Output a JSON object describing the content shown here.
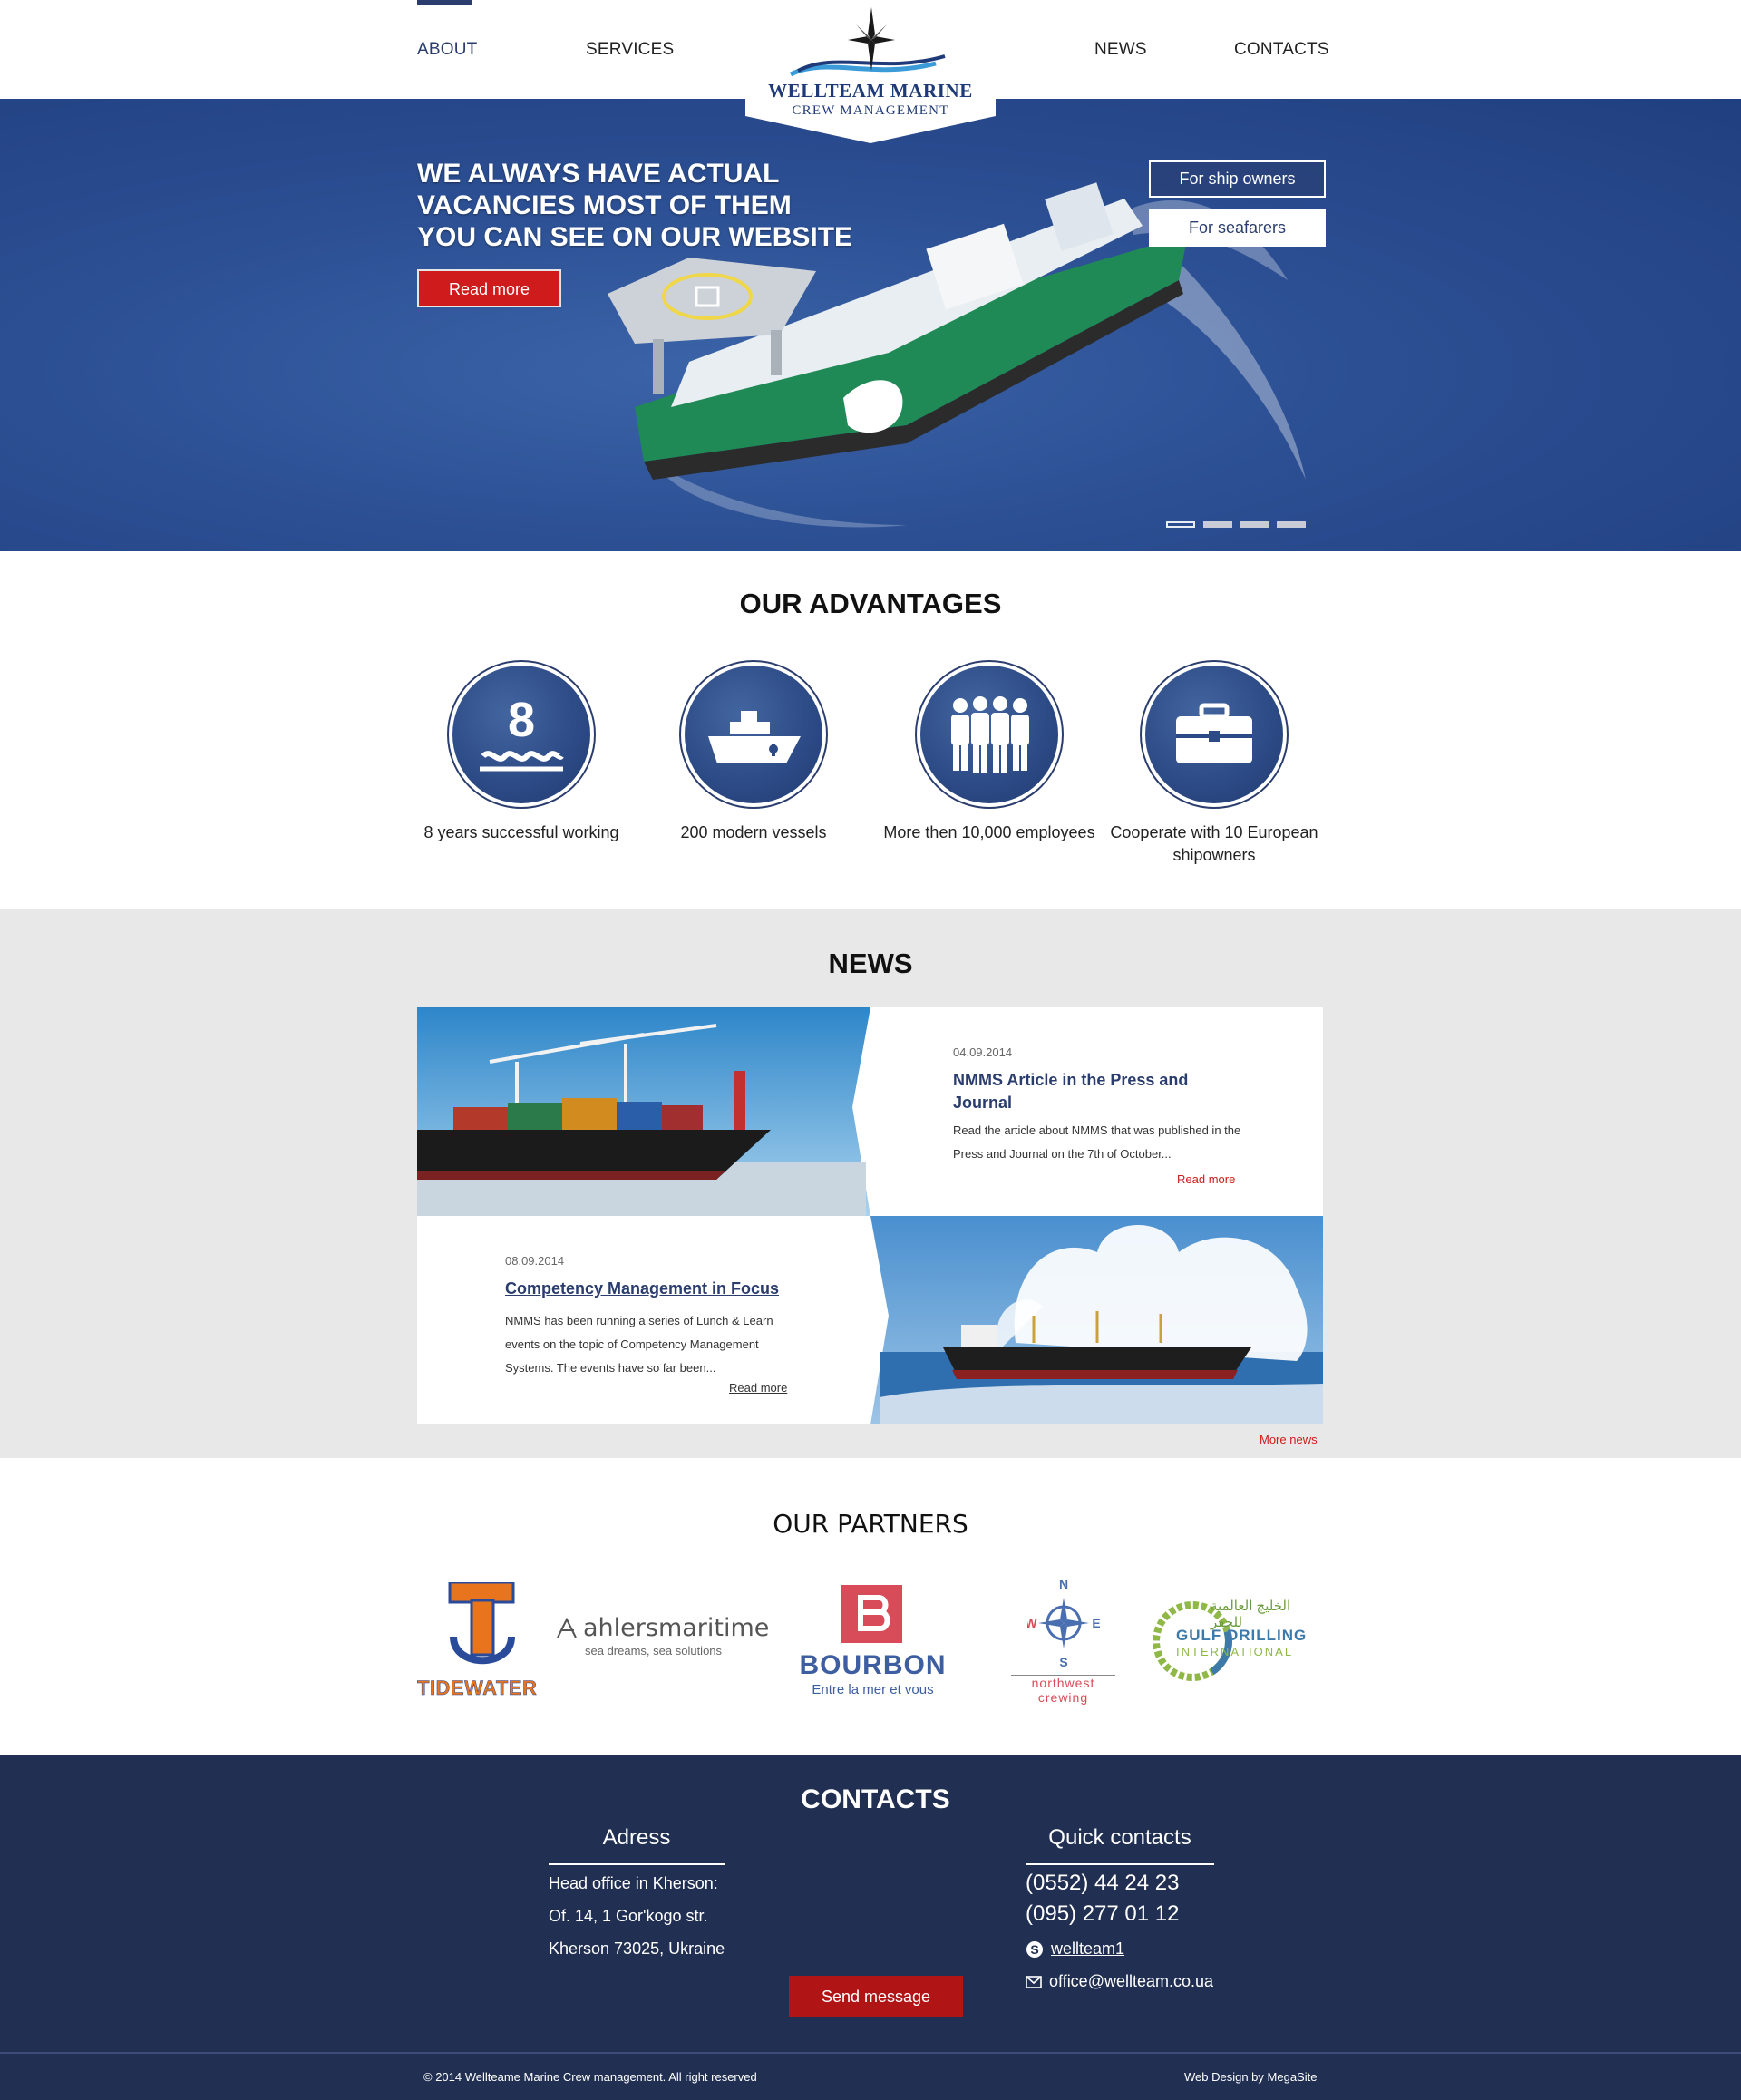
{
  "nav": {
    "about": "ABOUT",
    "services": "SERVICES",
    "news": "NEWS",
    "contacts": "CONTACTS"
  },
  "logo": {
    "title": "WELLTEAM MARINE",
    "subtitle": "CREW MANAGEMENT",
    "icon": "compass-rose-icon"
  },
  "hero": {
    "title_lines": [
      "WE ALWAYS HAVE ACTUAL",
      "VACANCIES MOST OF THEM",
      "YOU CAN SEE ON OUR WEBSITE"
    ],
    "read_more": "Read more",
    "btn_ship_owners": "For ship owners",
    "btn_seafarers": "For seafarers",
    "slides_total": 4,
    "active_slide": 1
  },
  "advantages": {
    "title": "OUR ADVANTAGES",
    "items": [
      {
        "icon": "eight-years-icon",
        "number": "8",
        "label": "8 years successful working"
      },
      {
        "icon": "ship-icon",
        "label": "200 modern vessels"
      },
      {
        "icon": "employees-icon",
        "label": "More then 10,000 employees"
      },
      {
        "icon": "briefcase-icon",
        "label": "Cooperate with 10 European shipowners"
      }
    ]
  },
  "news": {
    "title": "NEWS",
    "items": [
      {
        "date": "04.09.2014",
        "heading": "NMMS Article in the Press and Journal",
        "text": "Read the article about NMMS that was published in the Press and Journal on the 7th of October...",
        "read_more": "Read more"
      },
      {
        "date": "08.09.2014",
        "heading": "Competency Management in Focus",
        "text": "NMMS has been running a series of Lunch & Learn events on the topic of Competency Management Systems. The events have so far been...",
        "read_more": "Read more"
      }
    ],
    "more_news": "More news"
  },
  "partners": {
    "title": "OUR PARTNERS",
    "items": [
      {
        "name": "TIDEWATER"
      },
      {
        "name": "ahlersmaritime",
        "tagline": "sea dreams, sea solutions"
      },
      {
        "name": "BOURBON",
        "tagline": "Entre la mer et vous"
      },
      {
        "name": "northwest crewing",
        "compass_letters": [
          "N",
          "W",
          "E",
          "S"
        ]
      },
      {
        "name": "GULF DRILLING",
        "name2": "INTERNATIONAL",
        "arabic": "الخليج العالمية للحفر"
      }
    ]
  },
  "contacts": {
    "title": "CONTACTS",
    "address_heading": "Adress",
    "address_lines": [
      "Head office in Kherson:",
      "Of. 14, 1 Gor'kogo str.",
      "Kherson 73025, Ukraine"
    ],
    "quick_heading": "Quick contacts",
    "phones": [
      "(0552) 44 24 23",
      "(095) 277 01 12"
    ],
    "skype": "wellteam1",
    "email": "office@wellteam.co.ua",
    "send_button": "Send message"
  },
  "footer": {
    "copyright": "© 2014 Wellteame Marine Crew management. All right reserved",
    "credit": "Web Design by MegaSite"
  },
  "colors": {
    "navy": "#2a3d6e",
    "footer_navy": "#213052",
    "accent_red": "#cf1b1b",
    "news_bg": "#e8e8e8"
  }
}
